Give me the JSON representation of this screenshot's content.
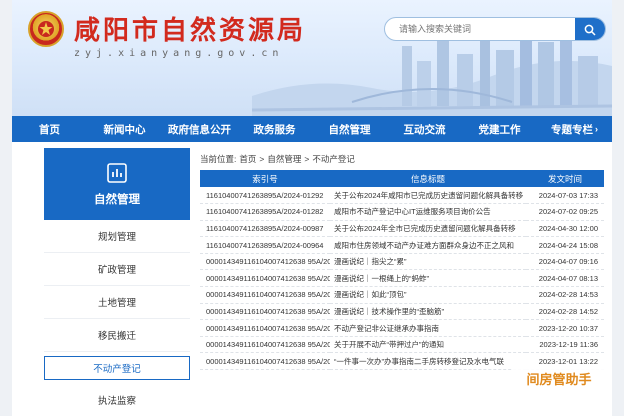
{
  "header": {
    "title": "咸阳市自然资源局",
    "url": "zyj.xianyang.gov.cn",
    "search_placeholder": "请输入搜索关键词",
    "search_icon": "search-icon"
  },
  "nav": {
    "items": [
      "首页",
      "新闻中心",
      "政府信息公开",
      "政务服务",
      "自然管理",
      "互动交流",
      "党建工作",
      "专题专栏"
    ],
    "last_arrow": "›"
  },
  "sidebar": {
    "title": "自然管理",
    "items": [
      "规划管理",
      "矿政管理",
      "土地管理",
      "移民搬迁",
      "不动产登记",
      "执法监察"
    ],
    "active_index": 4
  },
  "breadcrumb": [
    "当前位置:",
    "首页",
    ">",
    "自然管理",
    ">",
    "不动产登记"
  ],
  "table": {
    "headers": [
      "索引号",
      "信息标题",
      "发文时间"
    ],
    "rows": [
      [
        "11610400741263895A/2024-01292",
        "关于公布2024年咸阳市已完成历史遗留问题化解具备转移",
        "2024-07-03 17:33"
      ],
      [
        "11610400741263895A/2024-01282",
        "咸阳市不动产登记中心IT运维服务项目询价公告",
        "2024-07-02 09:25"
      ],
      [
        "11610400741263895A/2024-00987",
        "关于公布2024年全市已完成历史遗留问题化解具备转移",
        "2024-04-30 12:00"
      ],
      [
        "11610400741263895A/2024-00964",
        "咸阳市住房领域不动产办证难方面群众身边不正之风和",
        "2024-04-24 15:08"
      ],
      [
        "000014349116104007412638 95A/20",
        "漫画说纪｜指尖之“累”",
        "2024-04-07 09:16"
      ],
      [
        "000014349116104007412638 95A/20",
        "漫画说纪｜一根绳上的“蚂蚱”",
        "2024-04-07 08:13"
      ],
      [
        "000014349116104007412638 95A/20",
        "漫画说纪｜如此“顶包”",
        "2024-02-28 14:53"
      ],
      [
        "000014349116104007412638 95A/20",
        "漫画说纪｜技术操作里的“歪脑筋”",
        "2024-02-28 14:52"
      ],
      [
        "000014349116104007412638 95A/20",
        "不动产登记非公证继承办事指南",
        "2023-12-20 10:37"
      ],
      [
        "000014349116104007412638 95A/20",
        "关于开展不动产“带押过户”的通知",
        "2023-12-19 11:36"
      ],
      [
        "000014349116104007412638 95A/20",
        "“一件事一次办”办事指南二手房转移登记及水电气联",
        "2023-12-01 13:22"
      ]
    ]
  },
  "watermark": "间房管助手",
  "colors": {
    "primary": "#1869c4",
    "title_red": "#d22a1e",
    "watermark": "#e08a1e"
  }
}
